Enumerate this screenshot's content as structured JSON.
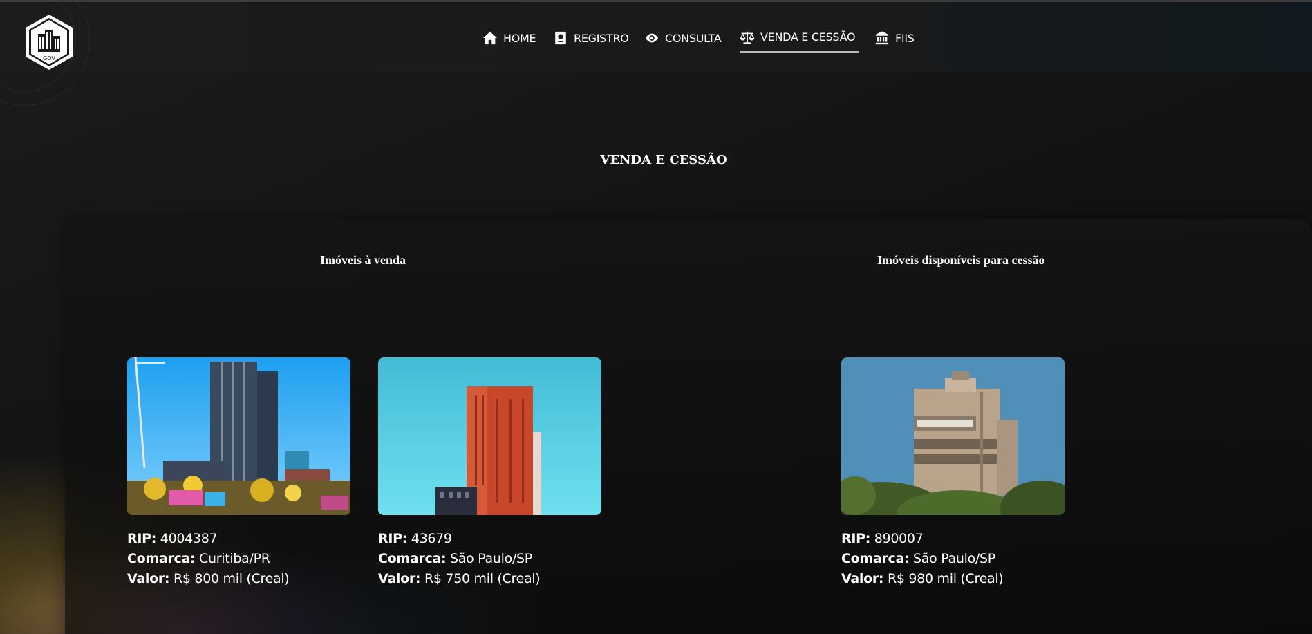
{
  "nav": {
    "items": [
      {
        "label": "HOME",
        "icon": "home-icon"
      },
      {
        "label": "REGISTRO",
        "icon": "passport-icon"
      },
      {
        "label": "CONSULTA",
        "icon": "eye-icon"
      },
      {
        "label": "VENDA E CESSÃO",
        "icon": "scale-icon",
        "active": true
      },
      {
        "label": "FIIS",
        "icon": "bank-icon"
      }
    ]
  },
  "logo": {
    "text": "GOV"
  },
  "page": {
    "title": "VENDA E CESSÃO"
  },
  "sections": {
    "venda": {
      "title": "Imóveis à venda"
    },
    "cessao": {
      "title": "Imóveis disponíveis para cessão"
    }
  },
  "labels": {
    "rip": "RIP:",
    "comarca": "Comarca:",
    "valor": "Valor:"
  },
  "cards": [
    {
      "rip": "4004387",
      "comarca": "Curitiba/PR",
      "valor": "R$ 800 mil (Creal)"
    },
    {
      "rip": "43679",
      "comarca": "São Paulo/SP",
      "valor": "R$ 750 mil (Creal)"
    },
    {
      "rip": "890007",
      "comarca": "São Paulo/SP",
      "valor": "R$ 980 mil (Creal)"
    }
  ],
  "colors": {
    "background": "#141414",
    "active_underline": "#b9b9b9"
  }
}
